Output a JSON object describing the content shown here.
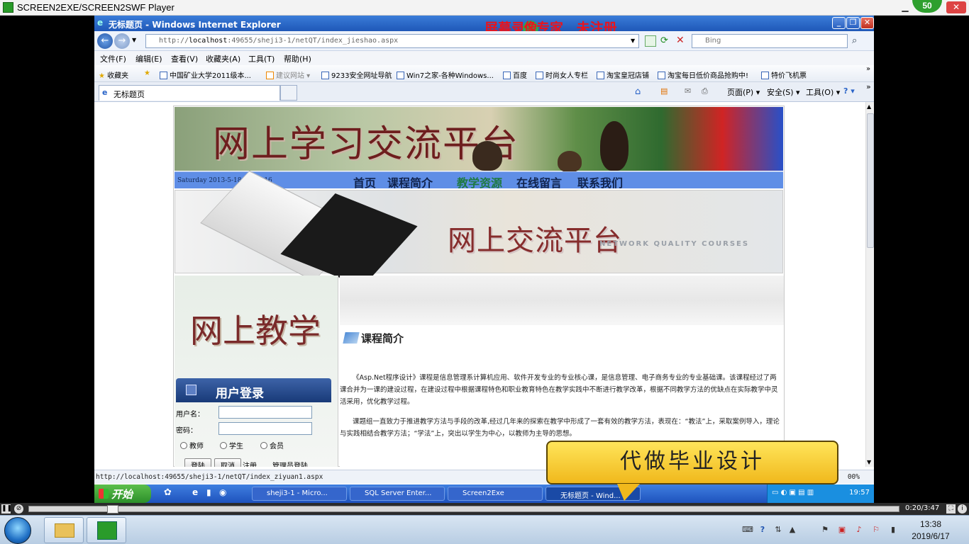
{
  "player": {
    "title": "SCREEN2EXE/SCREEN2SWF Player",
    "badge": "50",
    "time": "0:20/3:47"
  },
  "ie": {
    "title": "无标题页 - Windows Internet Explorer",
    "watermark_left": "屏幕录",
    "watermark_mid": "像",
    "watermark_right": "专家",
    "watermark_tag": "未注册",
    "url_prefix": "http://",
    "url_host": "localhost",
    "url_rest": ":49655/sheji3-1/netQT/index_jieshao.aspx",
    "search_placeholder": "Bing",
    "menu": [
      "文件(F)",
      "编辑(E)",
      "查看(V)",
      "收藏夹(A)",
      "工具(T)",
      "帮助(H)"
    ],
    "favorites_label": "收藏夹",
    "favorites": [
      "中国矿业大学2011级本...",
      "建议网站 ▾",
      "9233安全网址导航",
      "Win7之家-各种Windows...",
      "百度",
      "时尚女人专栏",
      "淘宝皇冠店铺",
      "淘宝每日低价商品抢购中!",
      "特价飞机票"
    ],
    "tab_title": "无标题页",
    "commands": [
      "页面(P) ▾",
      "安全(S) ▾",
      "工具(O) ▾"
    ],
    "status_url": "http://localhost:49655/sheji3-1/netQT/index_ziyuan1.aspx",
    "zoom": "00%"
  },
  "site": {
    "banner_title": "网上学习交流平台",
    "date": "Saturday    2013-5-18 19:57:16",
    "nav": [
      "首页",
      "课程简介",
      "教学资源",
      "在线留言",
      "联系我们"
    ],
    "active_nav": "教学资源",
    "hero_title": "网上交流平台",
    "hero_sub": "NETWORK QUALITY COURSES",
    "left_title": "网上教学",
    "login": {
      "header": "用户登录",
      "username_label": "用户名：",
      "password_label": "密码：",
      "roles": [
        "教师",
        "学生",
        "会员"
      ],
      "login_btn": "登陆",
      "cancel_btn": "取消",
      "register": "注册",
      "admin": "管理员登陆"
    },
    "section_title": "课程简介",
    "para1": "《Asp.Net程序设计》课程是信息管理系计算机应用、软件开发专业的专业核心课，是信息管理、电子商务专业的专业基础课。该课程经过了两课合并为一课的建设过程，在建设过程中根据课程特色和职业教育特色在教学实践中不断进行教学改革，根据不同教学方法的优缺点在实际教学中灵活采用，优化教学过程。",
    "para2": "课题组一直致力于推进教学方法与手段的改革,经过几年来的探索在教学中形成了一套有效的教学方法，表现在：“教法”上，采取案例导入，理论与实践相结合教学方法；“学法”上，突出以学生为中心，以教师为主导的思想。"
  },
  "xp_taskbar": {
    "start": "开始",
    "items": [
      "sheji3-1 - Micro...",
      "SQL Server Enter...",
      "Screen2Exe",
      "无标题页 - Wind..."
    ],
    "clock": "19:57"
  },
  "bubble_text": "代做毕业设计",
  "win7": {
    "time": "13:38",
    "date": "2019/6/17"
  }
}
